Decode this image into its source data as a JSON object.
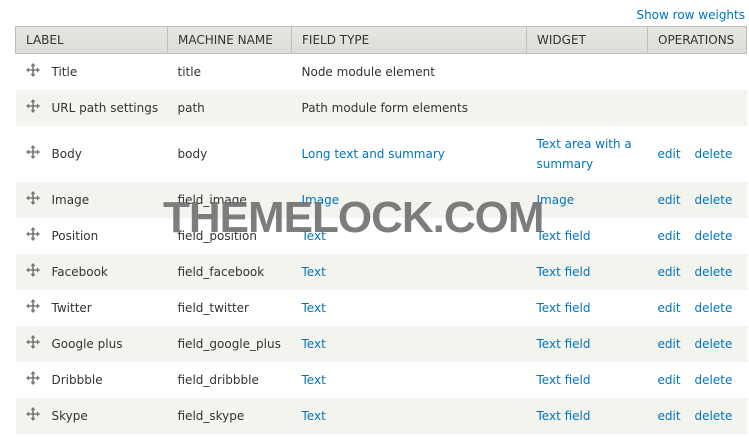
{
  "toplink": "Show row weights",
  "columns": {
    "label": "LABEL",
    "machine_name": "MACHINE NAME",
    "field_type": "FIELD TYPE",
    "widget": "WIDGET",
    "operations": "OPERATIONS"
  },
  "rows": [
    {
      "label": "Title",
      "machine": "title",
      "type": "Node module element",
      "widget": "",
      "edit": "",
      "delete": ""
    },
    {
      "label": "URL path settings",
      "machine": "path",
      "type": "Path module form elements",
      "widget": "",
      "edit": "",
      "delete": ""
    },
    {
      "label": "Body",
      "machine": "body",
      "type": "Long text and summary",
      "widget": "Text area with a summary",
      "edit": "edit",
      "delete": "delete"
    },
    {
      "label": "Image",
      "machine": "field_image",
      "type": "Image",
      "widget": "Image",
      "edit": "edit",
      "delete": "delete"
    },
    {
      "label": "Position",
      "machine": "field_position",
      "type": "Text",
      "widget": "Text field",
      "edit": "edit",
      "delete": "delete"
    },
    {
      "label": "Facebook",
      "machine": "field_facebook",
      "type": "Text",
      "widget": "Text field",
      "edit": "edit",
      "delete": "delete"
    },
    {
      "label": "Twitter",
      "machine": "field_twitter",
      "type": "Text",
      "widget": "Text field",
      "edit": "edit",
      "delete": "delete"
    },
    {
      "label": "Google plus",
      "machine": "field_google_plus",
      "type": "Text",
      "widget": "Text field",
      "edit": "edit",
      "delete": "delete"
    },
    {
      "label": "Dribbble",
      "machine": "field_dribbble",
      "type": "Text",
      "widget": "Text field",
      "edit": "edit",
      "delete": "delete"
    },
    {
      "label": "Skype",
      "machine": "field_skype",
      "type": "Text",
      "widget": "Text field",
      "edit": "edit",
      "delete": "delete"
    }
  ],
  "watermark": "THEMELOCK.COM"
}
